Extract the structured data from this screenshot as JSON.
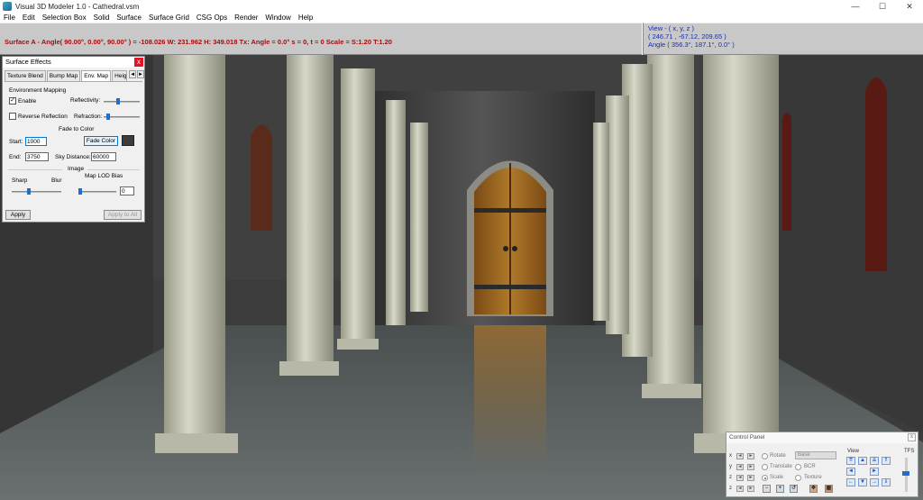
{
  "window": {
    "title": "Visual 3D Modeler 1.0 - Cathedral.vsm",
    "minimize": "—",
    "maximize": "☐",
    "close": "✕"
  },
  "menu": [
    "File",
    "Edit",
    "Selection Box",
    "Solid",
    "Surface",
    "Surface Grid",
    "CSG Ops",
    "Render",
    "Window",
    "Help"
  ],
  "status": {
    "text": "Surface A - Angle( 90.00°, 0.00°, 90.00° ) = -108.026   W: 231.962   H: 349.018   Tx: Angle = 0.0°   s = 0, t = 0   Scale = S:1.20 T:1.20"
  },
  "view": {
    "header": "View - ( x, y, z )",
    "position": "( 246.71 , -67.12, 209.65 )",
    "angle": "Angle ( 356.3°, 187.1°, 0.0° )"
  },
  "surface_effects": {
    "title": "Surface Effects",
    "close": "x",
    "tabs": [
      "Texture Blend",
      "Bump Map",
      "Env. Map",
      "Height M"
    ],
    "tab_prev": "◄",
    "tab_next": "►",
    "env_mapping_label": "Environment Mapping",
    "enable_label": "Enable",
    "enable_checked": "✓",
    "reflectivity_label": "Reflectivity:",
    "reverse_reflection_label": "Reverse Reflection",
    "refraction_label": "Refraction:",
    "fade_to_color_label": "Fade to Color",
    "start_label": "Start:",
    "start_value": "1000",
    "fade_color_button": "Fade Color",
    "end_label": "End:",
    "end_value": "3750",
    "sky_distance_label": "Sky Distance:",
    "sky_distance_value": "60000",
    "image_label": "Image",
    "sharp_label": "Sharp",
    "blur_label": "Blur",
    "lod_bias_label": "Map LOD Bias",
    "lod_bias_value": "0",
    "apply_button": "Apply",
    "apply_all_button": "Apply to All",
    "fade_color": "#3c3c3c",
    "sliders": {
      "reflectivity": 0.4,
      "refraction": 0.12,
      "sharp_blur": 0.35,
      "lod_bias": 0.05
    }
  },
  "control_panel": {
    "title": "Control Panel",
    "close": "x",
    "rows": [
      "x",
      "y",
      "z",
      "z"
    ],
    "rotate": "Rotate",
    "translate": "Translate",
    "scale": "Scale",
    "base_select": "Base",
    "bcr": "BCR",
    "texture": "Texture",
    "view_label": "View",
    "tfs_label": "TFS"
  }
}
